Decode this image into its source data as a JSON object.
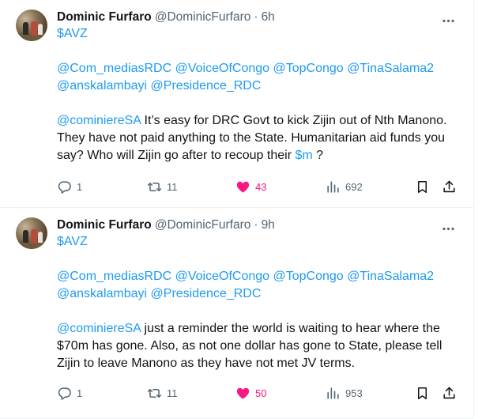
{
  "tweets": [
    {
      "name": "Dominic Furfaro",
      "handle": "@DominicFurfaro",
      "separator": "·",
      "time": "6h",
      "cashtag": "$AVZ",
      "mentions_line1": [
        "@Com_mediasRDC",
        "@VoiceOfCongo",
        "@TopCongo",
        "@TinaSalama2"
      ],
      "mentions_line2": [
        "@anskalambayi",
        "@Presidence_RDC"
      ],
      "reply_mention": "@cominiereSA",
      "text_part1": " It’s easy for DRC Govt to kick Zijin out of Nth Manono. They have not paid anything to the State. Humanitarian aid funds you say? Who will Zijin go after to recoup their ",
      "text_link": "$m",
      "text_part2": " ?",
      "replies": "1",
      "reposts": "11",
      "likes": "43",
      "views": "692"
    },
    {
      "name": "Dominic Furfaro",
      "handle": "@DominicFurfaro",
      "separator": "·",
      "time": "9h",
      "cashtag": "$AVZ",
      "mentions_line1": [
        "@Com_mediasRDC",
        "@VoiceOfCongo",
        "@TopCongo",
        "@TinaSalama2"
      ],
      "mentions_line2": [
        "@anskalambayi",
        "@Presidence_RDC"
      ],
      "reply_mention": "@cominiereSA",
      "text_part1": " just a reminder the world is waiting to hear where the $70m has gone. Also, as not one dollar has gone to State, please tell Zijin to leave Manono as they have not met JV terms.",
      "text_link": "",
      "text_part2": "",
      "replies": "1",
      "reposts": "11",
      "likes": "50",
      "views": "953"
    }
  ],
  "icons": {
    "more": "more-dots-icon",
    "reply": "reply-bubble-icon",
    "repost": "repost-arrows-icon",
    "like": "heart-filled-icon",
    "views": "views-bars-icon",
    "bookmark": "bookmark-icon",
    "share": "share-upload-icon"
  },
  "colors": {
    "link": "#1d9bf0",
    "like": "#f91880",
    "muted": "#536471",
    "text": "#0f1419"
  }
}
